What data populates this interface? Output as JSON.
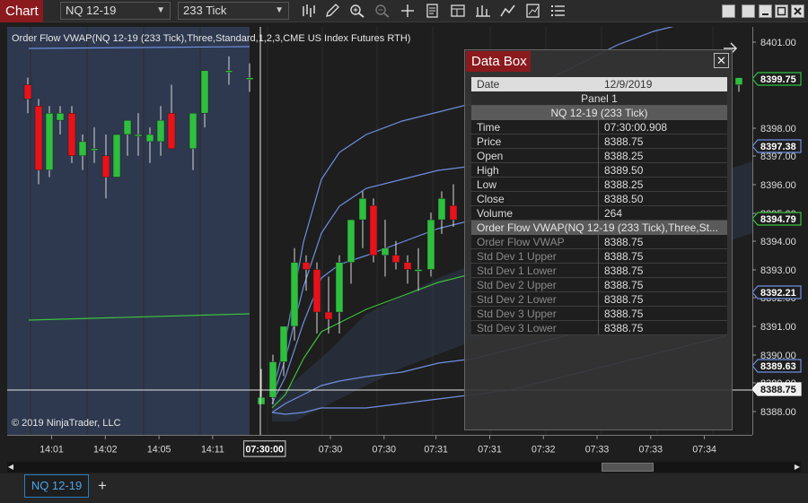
{
  "toolbar": {
    "tab_label": "Chart",
    "instrument": "NQ 12-19",
    "interval": "233 Tick",
    "tool_icons": [
      "bar-type-icon",
      "draw-pencil-icon",
      "zoom-in-icon",
      "zoom-out-icon",
      "crosshair-icon",
      "properties-icon",
      "data-box-icon",
      "strategies-icon",
      "indicators-icon",
      "chart-trader-icon",
      "more-icon"
    ]
  },
  "indicator_label": "Order Flow VWAP(NQ 12-19 (233 Tick),Three,Standard,1,2,3,CME US Index Futures RTH)",
  "copyright": "© 2019 NinjaTrader, LLC",
  "colors": {
    "up_candle": "#2fbf3f",
    "down_candle": "#e8121a",
    "vwap_line": "#3cc23c",
    "band_line": "#6e8fe0",
    "session_shade": "#354462",
    "accent": "#8b1a1f",
    "tab_accent": "#2a7fc1"
  },
  "price_axis": {
    "ticks": [
      "8401.00",
      "8398.00",
      "8397.00",
      "8396.00",
      "8395.00",
      "8394.00",
      "8393.00",
      "8392.00",
      "8391.00",
      "8390.00",
      "8389.00",
      "8388.00"
    ],
    "markers": [
      {
        "label": "8399.75",
        "color": "#2fbf3f"
      },
      {
        "label": "8397.38",
        "color": "#6e8fe0"
      },
      {
        "label": "8394.79",
        "color": "#3cc23c"
      },
      {
        "label": "8392.21",
        "color": "#6e8fe0"
      },
      {
        "label": "8389.63",
        "color": "#6e8fe0"
      },
      {
        "label": "8388.75",
        "color": "#ffffff"
      }
    ]
  },
  "time_axis": {
    "labels": [
      "14:01",
      "14:02",
      "14:05",
      "14:11",
      "07:30:00",
      "07:30",
      "07:30",
      "07:31",
      "07:31",
      "07:32",
      "07:33",
      "07:33",
      "07:34"
    ],
    "highlight": "07:30:00"
  },
  "databox": {
    "title": "Data Box",
    "date_label": "Date",
    "date_value": "12/9/2019",
    "panel": "Panel 1",
    "instrument_header": "NQ 12-19 (233 Tick)",
    "rows": [
      {
        "k": "Time",
        "v": "07:30:00.908"
      },
      {
        "k": "Price",
        "v": "8388.75"
      },
      {
        "k": "Open",
        "v": "8388.25"
      },
      {
        "k": "High",
        "v": "8389.50"
      },
      {
        "k": "Low",
        "v": "8388.25"
      },
      {
        "k": "Close",
        "v": "8388.50"
      },
      {
        "k": "Volume",
        "v": "264"
      }
    ],
    "indicator_header": "Order Flow VWAP(NQ 12-19 (233 Tick),Three,St...",
    "indicator_rows": [
      {
        "k": "Order Flow VWAP",
        "v": "8388.75"
      },
      {
        "k": "Std Dev 1 Upper",
        "v": "8388.75"
      },
      {
        "k": "Std Dev 1 Lower",
        "v": "8388.75"
      },
      {
        "k": "Std Dev 2 Upper",
        "v": "8388.75"
      },
      {
        "k": "Std Dev 2 Lower",
        "v": "8388.75"
      },
      {
        "k": "Std Dev 3 Upper",
        "v": "8388.75"
      },
      {
        "k": "Std Dev 3 Lower",
        "v": "8388.75"
      }
    ]
  },
  "bottom_tabs": {
    "active": "NQ 12-19",
    "add": "+"
  },
  "chart_data": {
    "type": "candlestick",
    "candles": [
      {
        "o": 8399.5,
        "h": 8399.75,
        "l": 8398.5,
        "c": 8399.0
      },
      {
        "o": 8398.75,
        "h": 8399.0,
        "l": 8396.0,
        "c": 8396.5
      },
      {
        "o": 8396.5,
        "h": 8398.75,
        "l": 8396.25,
        "c": 8398.5
      },
      {
        "o": 8398.25,
        "h": 8398.75,
        "l": 8397.75,
        "c": 8398.5
      },
      {
        "o": 8398.5,
        "h": 8398.75,
        "l": 8396.75,
        "c": 8397.0
      },
      {
        "o": 8397.0,
        "h": 8397.75,
        "l": 8396.5,
        "c": 8397.5
      },
      {
        "o": 8397.25,
        "h": 8398.0,
        "l": 8396.75,
        "c": 8397.25
      },
      {
        "o": 8397.0,
        "h": 8397.75,
        "l": 8395.5,
        "c": 8396.25
      },
      {
        "o": 8396.25,
        "h": 8397.75,
        "l": 8396.25,
        "c": 8397.75
      },
      {
        "o": 8397.75,
        "h": 8398.25,
        "l": 8397.0,
        "c": 8398.25
      },
      {
        "o": 8397.75,
        "h": 8398.5,
        "l": 8397.0,
        "c": 8397.75
      },
      {
        "o": 8397.5,
        "h": 8398.0,
        "l": 8396.75,
        "c": 8397.75
      },
      {
        "o": 8397.5,
        "h": 8398.75,
        "l": 8397.0,
        "c": 8398.25
      },
      {
        "o": 8398.5,
        "h": 8399.5,
        "l": 8397.5,
        "c": 8397.25
      },
      {
        "o": 8397.25,
        "h": 8398.5,
        "l": 8396.5,
        "c": 8398.5
      },
      {
        "o": 8398.5,
        "h": 8400.0,
        "l": 8398.0,
        "c": 8400.0
      },
      {
        "o": 8400.0,
        "h": 8400.5,
        "l": 8399.5,
        "c": 8400.0
      },
      {
        "o": 8399.75,
        "h": 8400.25,
        "l": 8399.25,
        "c": 8399.75
      },
      {
        "o": 8388.25,
        "h": 8389.5,
        "l": 8388.25,
        "c": 8388.5
      },
      {
        "o": 8388.5,
        "h": 8390.0,
        "l": 8388.25,
        "c": 8389.75
      },
      {
        "o": 8389.75,
        "h": 8391.0,
        "l": 8389.25,
        "c": 8391.0
      },
      {
        "o": 8391.0,
        "h": 8393.75,
        "l": 8390.5,
        "c": 8393.25
      },
      {
        "o": 8393.25,
        "h": 8393.5,
        "l": 8392.25,
        "c": 8393.0
      },
      {
        "o": 8393.0,
        "h": 8393.25,
        "l": 8390.75,
        "c": 8391.5
      },
      {
        "o": 8391.5,
        "h": 8392.75,
        "l": 8390.75,
        "c": 8391.25
      },
      {
        "o": 8391.5,
        "h": 8393.5,
        "l": 8390.75,
        "c": 8393.25
      },
      {
        "o": 8393.25,
        "h": 8394.75,
        "l": 8392.5,
        "c": 8394.75
      },
      {
        "o": 8394.75,
        "h": 8395.75,
        "l": 8393.75,
        "c": 8395.5
      },
      {
        "o": 8395.25,
        "h": 8395.5,
        "l": 8393.25,
        "c": 8393.5
      },
      {
        "o": 8393.5,
        "h": 8394.75,
        "l": 8392.75,
        "c": 8393.75
      },
      {
        "o": 8393.5,
        "h": 8394.0,
        "l": 8393.0,
        "c": 8393.25
      },
      {
        "o": 8393.25,
        "h": 8393.5,
        "l": 8392.5,
        "c": 8393.0
      },
      {
        "o": 8393.0,
        "h": 8393.75,
        "l": 8392.25,
        "c": 8393.0
      },
      {
        "o": 8393.0,
        "h": 8395.0,
        "l": 8392.75,
        "c": 8394.75
      },
      {
        "o": 8394.75,
        "h": 8395.75,
        "l": 8394.25,
        "c": 8395.5
      },
      {
        "o": 8395.25,
        "h": 8396.0,
        "l": 8394.5,
        "c": 8394.75
      },
      {
        "o": 8399.5,
        "h": 8399.75,
        "l": 8399.25,
        "c": 8399.75
      }
    ]
  }
}
